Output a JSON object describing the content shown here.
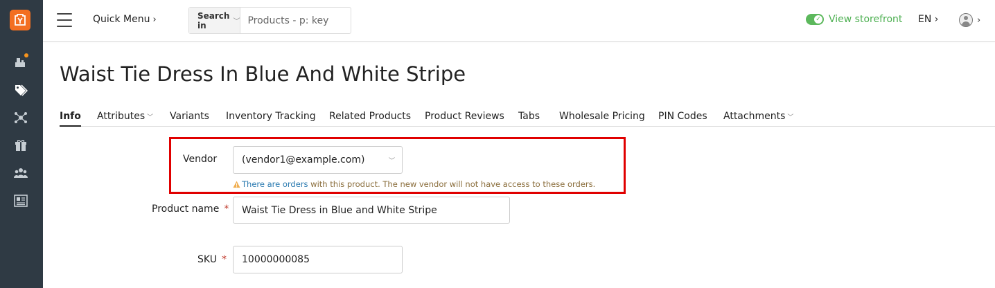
{
  "sidebar": {
    "icons": [
      "logo-icon",
      "addons-icon",
      "products-icon",
      "marketing-icon",
      "promotions-icon",
      "customers-icon",
      "website-icon"
    ],
    "colors": {
      "background": "#2f3a44",
      "logo": "#f36f21",
      "badge": "#f7941d"
    }
  },
  "topbar": {
    "quick_menu": "Quick Menu",
    "quick_menu_chevron": "›",
    "search_in_label": "Search in",
    "search_placeholder": "Products - p: key",
    "storefront_label": "View storefront",
    "language": "EN",
    "lang_chevron": "›",
    "user_chevron": "›"
  },
  "page": {
    "title": "Waist Tie Dress In Blue And White Stripe"
  },
  "tabs": [
    {
      "label": "Info",
      "active": true
    },
    {
      "label": "Attributes",
      "dropdown": true
    },
    {
      "label": "Variants"
    },
    {
      "label": "Inventory Tracking"
    },
    {
      "label": "Related Products"
    },
    {
      "label": "Product Reviews"
    },
    {
      "label": "Tabs"
    },
    {
      "label": "Wholesale Pricing"
    },
    {
      "label": "PIN Codes"
    },
    {
      "label": "Attachments",
      "dropdown": true
    }
  ],
  "form": {
    "vendor_label": "Vendor",
    "vendor_value": "(vendor1@example.com)",
    "warning_link": "There are orders",
    "warning_text": " with this product. The new vendor will not have access to these orders.",
    "product_name_label": "Product name",
    "product_name_value": "Waist Tie Dress in Blue and White Stripe",
    "sku_label": "SKU",
    "sku_value": "10000000085",
    "required_mark": "*"
  },
  "colors": {
    "highlight_border": "#e00000",
    "storefront_green": "#4caf50",
    "link_blue": "#2a7ab0",
    "warning_text": "#8a6d3b"
  }
}
